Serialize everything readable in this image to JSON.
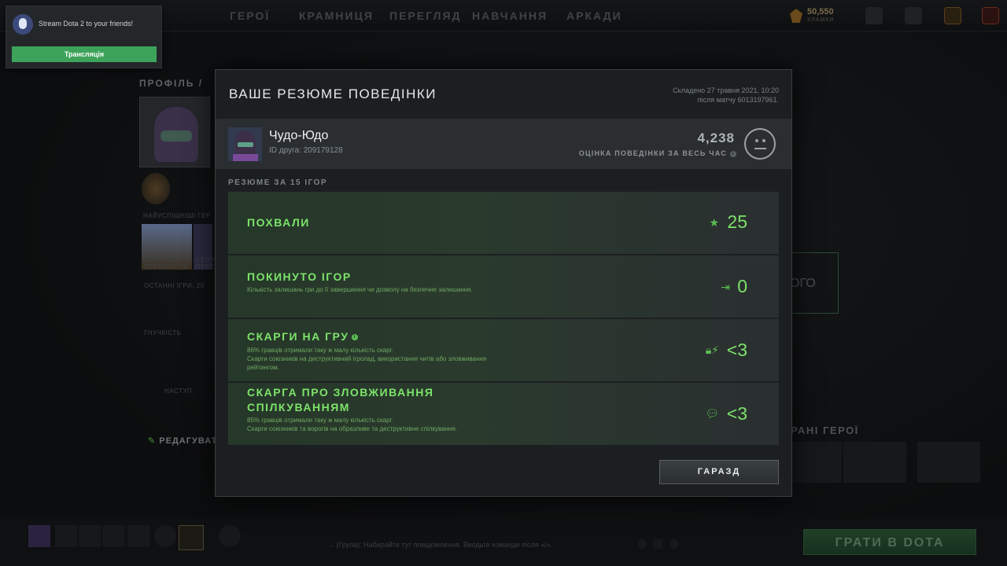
{
  "nav": {
    "items": [
      "ГЕРОЇ",
      "КРАМНИЦЯ",
      "ПЕРЕГЛЯД",
      "НАВЧАННЯ",
      "АРКАДИ"
    ],
    "shards_value": "50,550",
    "shards_label": "УЛАМКИ"
  },
  "notification": {
    "text": "Stream Dota 2 to your friends!",
    "button": "Трансляція"
  },
  "background": {
    "profile_label": "ПРОФІЛЬ",
    "profile_sep": "/",
    "best_heroes": "НАЙУСПІШНІШІ ГЕР",
    "series1": "СЕРІЯ 12",
    "series1b": "ПЕРЕМОГ УВ",
    "series2": "СЕРІЯ",
    "series2b": "ПЕРЕМ",
    "last_games": "ОСТАННІ ІГРИ: 20",
    "flex": "ГНУЧКІСТЬ",
    "push": "НАСТУП",
    "edit": "РЕДАГУВАТ",
    "right_box": "ОГО",
    "fav_heroes": "РАНІ ГЕРОЇ",
    "chat_hint": "→ (Група): Набирайте тут повідомлення. Вводьте команди після «/».",
    "play": "ГРАТИ В DOTA"
  },
  "modal": {
    "title": "ВАШЕ РЕЗЮМЕ ПОВЕДІНКИ",
    "compiled_line1": "Складено 27 травня 2021, 10:20",
    "compiled_line2": "після матчу 6013197961.",
    "user_name": "Чудо-Юдо",
    "user_id": "ID друга: 209179128",
    "score": "4,238",
    "score_label": "ОЦІНКА ПОВЕДІНКИ ЗА ВЕСЬ ЧАС",
    "summary_label": "РЕЗЮМЕ ЗА 15 ІГОР",
    "rows": [
      {
        "title": "ПОХВАЛИ",
        "value": "25",
        "icon": "star-icon"
      },
      {
        "title": "ПОКИНУТО ІГОР",
        "desc": "Кількість залишань гри до її завершення чи дозволу на безпечне залишання.",
        "value": "0",
        "icon": "exit-icon"
      },
      {
        "title": "СКАРГИ НА ГРУ",
        "desc1": "86% гравців отримали таку ж малу кількість скарг.",
        "desc2": "Скарги союзників на деструктивний ігролад, використання читів або зловживання рейтингом.",
        "value": "<3",
        "icon": "lock-bolt-icon"
      },
      {
        "title_line1": "СКАРГА ПРО ЗЛОВЖИВАННЯ",
        "title_line2": "СПІЛКУВАННЯМ",
        "desc1": "85% гравців отримали таку ж малу кількість скарг.",
        "desc2": "Скарги союзників та ворогів на образливе та деструктивне спілкування.",
        "value": "<3",
        "icon": "chat-icon"
      }
    ],
    "ok_button": "ГАРАЗД"
  },
  "colors": {
    "accent_green": "#7de36a",
    "play_green": "#1f3f27",
    "notify_green": "#3da35a"
  }
}
